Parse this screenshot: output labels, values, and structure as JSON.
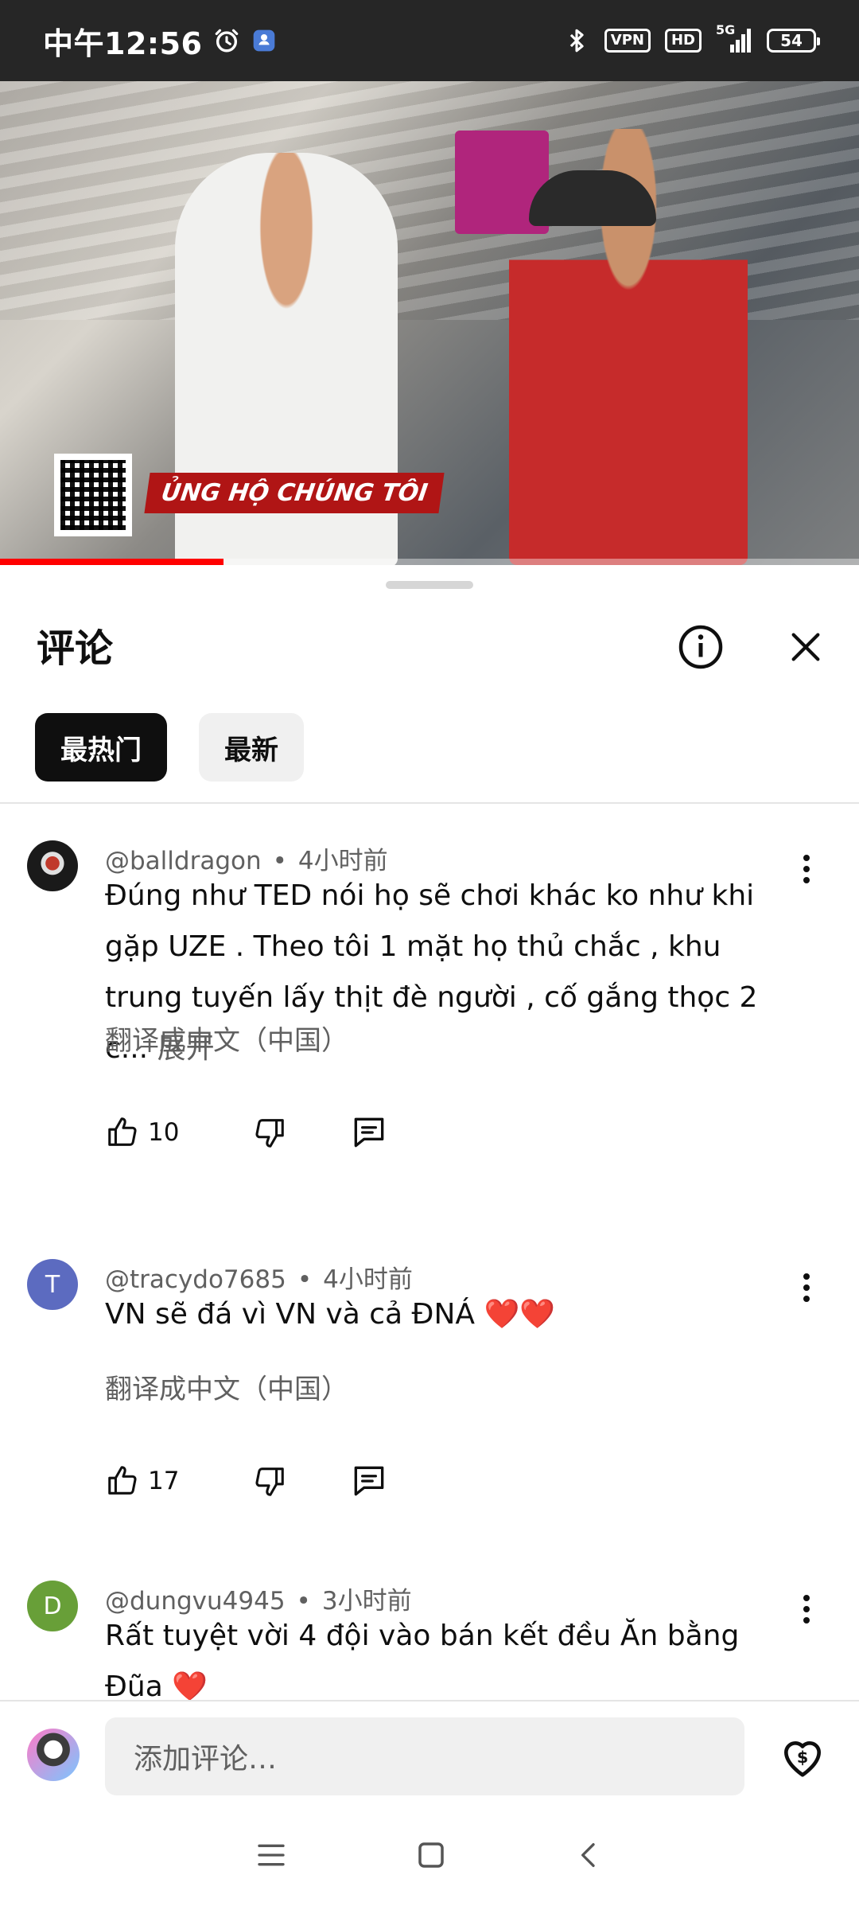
{
  "status_bar": {
    "time": "中午12:56",
    "vpn": "VPN",
    "hd": "HD",
    "network": "5G",
    "battery": "54"
  },
  "video": {
    "overlay_text": "ỦNG HỘ CHÚNG TÔI",
    "progress": 0.26
  },
  "sheet": {
    "title": "评论",
    "filters": [
      {
        "label": "最热门",
        "active": true
      },
      {
        "label": "最新",
        "active": false
      }
    ]
  },
  "comments": [
    {
      "author": "@balldragon",
      "time": "4小时前",
      "text": "Đúng như TED nói họ sẽ chơi khác ko như khi gặp UZE . Theo tôi 1 mặt họ thủ chắc , khu trung tuyến lấy thịt đè người , cố gắng thọc 2 c...",
      "expand": "展开",
      "translate": "翻译成中文（中国）",
      "likes": "10",
      "avatar_letter": "",
      "avatar_color": "#1a1a1a"
    },
    {
      "author": "@tracydo7685",
      "time": "4小时前",
      "text": "VN sẽ đá vì VN và cả ĐNÁ ❤️❤️",
      "translate": "翻译成中文（中国）",
      "likes": "17",
      "avatar_letter": "T",
      "avatar_color": "#5c6bc0"
    },
    {
      "author": "@dungvu4945",
      "time": "3小时前",
      "text": "Rất tuyệt vời 4 đội vào bán kết đều Ăn bằng Đũa ❤️",
      "avatar_letter": "D",
      "avatar_color": "#689f38"
    }
  ],
  "composer": {
    "placeholder": "添加评论…"
  },
  "colors": {
    "accent_progress": "#ff0000",
    "text_primary": "#0f0f0f",
    "text_secondary": "#606060"
  }
}
